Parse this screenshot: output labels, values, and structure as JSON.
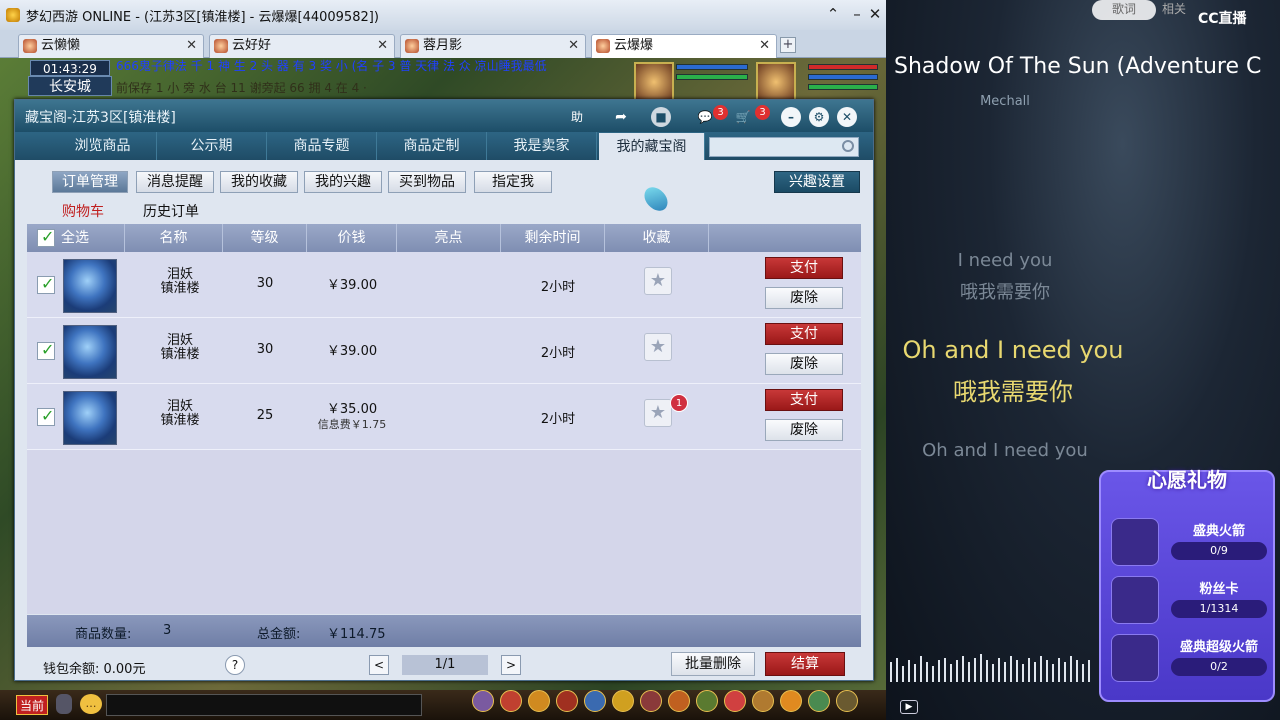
{
  "window": {
    "title": "梦幻西游 ONLINE - (江苏3区[镇淮楼] - 云爆爆[44009582])"
  },
  "game_tabs": [
    {
      "label": "云懒懒"
    },
    {
      "label": "云好好"
    },
    {
      "label": "蓉月影"
    },
    {
      "label": "云爆爆"
    }
  ],
  "hud": {
    "time": "01:43:29",
    "city": "长安城",
    "scroll_line1": "666鬼子律法   千 1 神 生 2 头  器  有 3 奖 小  (名 子 3   普 天律 法 众   凉山睡我最低",
    "scroll_line2": "前保存 1 小 旁 水 台 11  谢旁起 66   拥 4  在 4  ·"
  },
  "shop": {
    "title": "藏宝阁-江苏3区[镇淮楼]",
    "help_label": "助",
    "chat_badge": "3",
    "cart_badge": "3",
    "nav_tabs": [
      {
        "label": "浏览商品"
      },
      {
        "label": "公示期"
      },
      {
        "label": "商品专题"
      },
      {
        "label": "商品定制"
      },
      {
        "label": "我是卖家"
      },
      {
        "label": "我的藏宝阁"
      }
    ],
    "search_placeholder": "",
    "sub_tabs": [
      {
        "label": "订单管理"
      },
      {
        "label": "消息提醒"
      },
      {
        "label": "我的收藏"
      },
      {
        "label": "我的兴趣"
      },
      {
        "label": "买到物品"
      },
      {
        "label": "指定我"
      }
    ],
    "interest_button": "兴趣设置",
    "cart_link": "购物车",
    "history_link": "历史订单",
    "table": {
      "headers": [
        "全选",
        "名称",
        "等级",
        "价钱",
        "亮点",
        "剩余时间",
        "收藏"
      ],
      "rows": [
        {
          "name_line1": "泪妖",
          "name_line2": "镇淮楼",
          "level": "30",
          "price": "￥39.00",
          "fee": "",
          "time_left": "2小时",
          "fav_badge": "",
          "pay": "支付",
          "remove": "废除"
        },
        {
          "name_line1": "泪妖",
          "name_line2": "镇淮楼",
          "level": "30",
          "price": "￥39.00",
          "fee": "",
          "time_left": "2小时",
          "fav_badge": "",
          "pay": "支付",
          "remove": "废除"
        },
        {
          "name_line1": "泪妖",
          "name_line2": "镇淮楼",
          "level": "25",
          "price": "￥35.00",
          "fee": "信息费￥1.75",
          "time_left": "2小时",
          "fav_badge": "1",
          "pay": "支付",
          "remove": "废除"
        }
      ]
    },
    "summary": {
      "count_label": "商品数量:",
      "count_value": "3",
      "total_label": "总金额:",
      "total_value": "￥114.75"
    },
    "footer": {
      "wallet": "钱包余额: 0.00元",
      "help": "?",
      "page": "1/1",
      "prev": "<",
      "next": ">",
      "batch_delete": "批量删除",
      "checkout": "结算"
    }
  },
  "game_bottom": {
    "now_label": "当前"
  },
  "music": {
    "top_lyrics_btn": "歌词",
    "top_related_btn": "相关",
    "logo": "CC直播",
    "song_title": "Shadow Of The Sun (Adventure C",
    "artist": "Mechall",
    "lyric_prev_en": "I need you",
    "lyric_prev_cn": "哦我需要你",
    "lyric_cur_en": "Oh and I need you",
    "lyric_cur_cn": "哦我需要你",
    "lyric_next_en": "Oh and I need you"
  },
  "wish": {
    "title": "心愿礼物",
    "gifts": [
      {
        "name": "盛典火箭",
        "progress": "0/9",
        "fraction": 0
      },
      {
        "name": "粉丝卡",
        "progress": "1/1314",
        "fraction": 0.001
      },
      {
        "name": "盛典超级火箭",
        "progress": "0/2",
        "fraction": 0
      }
    ]
  },
  "colors": {
    "accent": "#1d4e68",
    "pay": "#b52828",
    "lyric_active": "#e8d870"
  }
}
